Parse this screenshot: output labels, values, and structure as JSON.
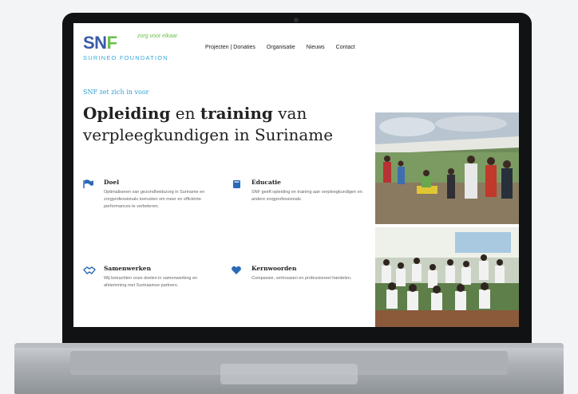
{
  "logo": {
    "mark": "SNF",
    "tagline": "zorg voor elkaar",
    "subtitle": "SURINEO FOUNDATION"
  },
  "nav": {
    "items": [
      "Projecten | Donaties",
      "Organisatie",
      "Nieuws",
      "Contact"
    ]
  },
  "hero": {
    "kicker": "SNF zet zich in voor",
    "title_bold1": "Opleiding",
    "title_mid": " en ",
    "title_bold2": "training",
    "title_rest": " van verpleegkundigen in Suriname"
  },
  "features": [
    {
      "icon": "flag-icon",
      "title": "Doel",
      "body": "Optimaliseren van gezondheidszorg in Suriname en zorgprofessionals toerusten om meer en efficiënte performances te verbeteren."
    },
    {
      "icon": "book-icon",
      "title": "Educatie",
      "body": "SNF geeft opleiding en training aan verpleegkundigen en andere zorgprofessionals."
    },
    {
      "icon": "handshake-icon",
      "title": "Samenwerken",
      "body": "Wij betrachten onze doelen in samenwerking en afstemming met Surinaamse partners."
    },
    {
      "icon": "heart-icon",
      "title": "Kernwoorden",
      "body": "Compassie, vertrouwen en professioneel handelen."
    }
  ],
  "colors": {
    "brand_blue": "#3a5ba8",
    "brand_green": "#6ac047",
    "accent_blue": "#2e9fd6"
  }
}
